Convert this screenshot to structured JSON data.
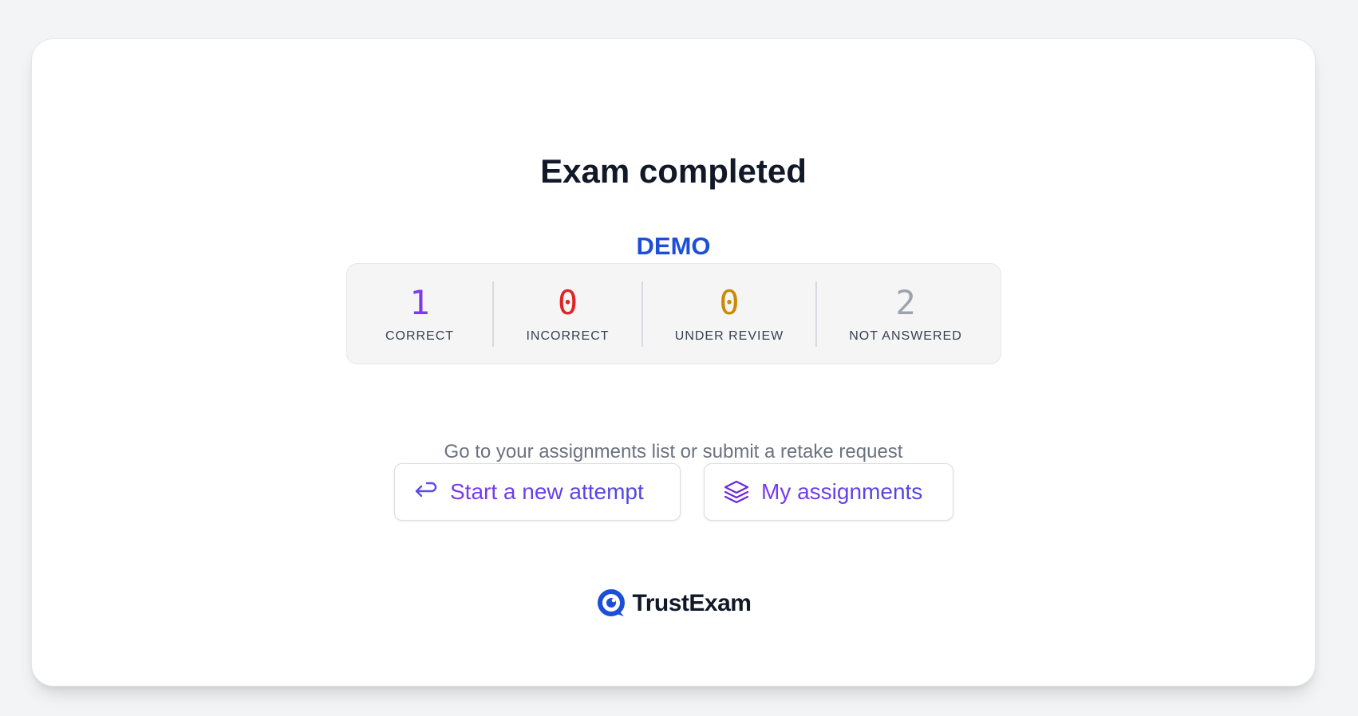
{
  "header": {
    "title": "Exam completed",
    "exam_name": "DEMO"
  },
  "stats": [
    {
      "value": "1",
      "label": "CORRECT",
      "color": "#7c3aed"
    },
    {
      "value": "0",
      "label": "INCORRECT",
      "color": "#dc2626"
    },
    {
      "value": "0",
      "label": "UNDER REVIEW",
      "color": "#ca8a04"
    },
    {
      "value": "2",
      "label": "NOT ANSWERED",
      "color": "#9ca3af"
    }
  ],
  "hint": "Go to your assignments list or submit a retake request",
  "actions": {
    "retake_label": "Start a new attempt",
    "retake_icon": "return-arrow-icon",
    "assignments_label": "My assignments",
    "assignments_icon": "layers-icon"
  },
  "brand": {
    "name": "TrustExam",
    "logo_icon": "trustexam-logo-icon",
    "accent": "#1d4ed8"
  }
}
